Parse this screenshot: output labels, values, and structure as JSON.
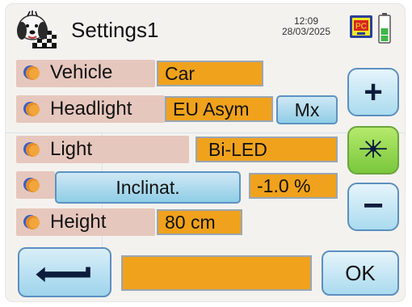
{
  "header": {
    "title": "Settings1",
    "time": "12:09",
    "date": "28/03/2025",
    "status_badge": "PC"
  },
  "rows": {
    "vehicle": {
      "label": "Vehicle",
      "value": "Car"
    },
    "headlight": {
      "label": "Headlight",
      "value": "EU Asym",
      "button": "Mx"
    },
    "light": {
      "label": "Light",
      "value": "Bi-LED"
    },
    "inclination": {
      "button": "Inclinat.",
      "value": "-1.0 %"
    },
    "height": {
      "label": "Height",
      "value": "80 cm"
    }
  },
  "side_buttons": {
    "plus": "+",
    "minus": "−"
  },
  "footer": {
    "ok_label": "OK",
    "message": ""
  },
  "colors": {
    "value_fill": "#f0a21c",
    "label_fill": "#e6c7bd",
    "button_blue": "#8fcde6",
    "button_green": "#79c73c"
  },
  "icons": {
    "logo": "dog-checkered-flag-icon",
    "status": "pc-badge-icon",
    "battery": "battery-icon",
    "back": "back-arrow-icon",
    "light_toggle": "light-beam-icon"
  }
}
